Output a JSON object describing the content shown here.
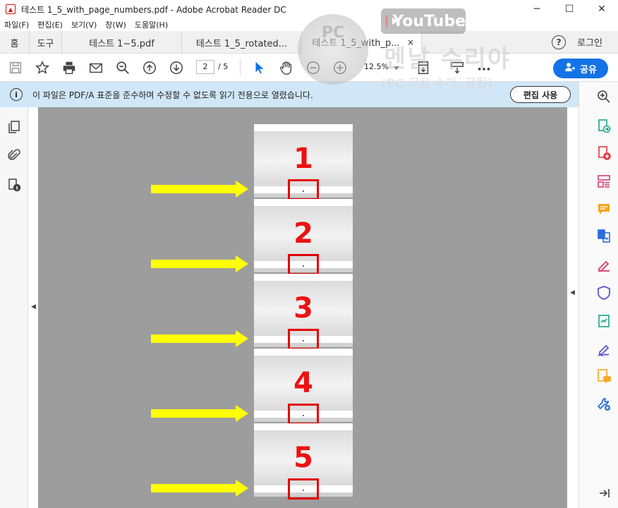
{
  "window": {
    "title": "테스트 1_5_with_page_numbers.pdf - Adobe Acrobat Reader DC",
    "minimize": "─",
    "maximize": "☐",
    "close": "✕"
  },
  "menu": [
    "파일(F)",
    "편집(E)",
    "보기(V)",
    "창(W)",
    "도움말(H)"
  ],
  "tabs": {
    "home": "홈",
    "tools": "도구",
    "docs": [
      "테스트 1~5.pdf",
      "테스트 1_5_rotated...",
      "테스트 1_5_with_p..."
    ],
    "close": "×",
    "help": "?",
    "login": "로그인"
  },
  "toolbar": {
    "page_current": "2",
    "page_total": "/ 5",
    "zoom": "12.5%",
    "share_label": "공유"
  },
  "banner": {
    "icon": "i",
    "message": "이 파일은 PDF/A 표준을 준수하며 수정할 수 없도록 읽기 전용으로 열렸습니다.",
    "edit_label": "편집 사용"
  },
  "pages": [
    "1",
    "2",
    "3",
    "4",
    "5"
  ],
  "watermark": {
    "youtube": "YouTube",
    "title": "멘날 수리야",
    "subtitle": "(PC 무료 수리, 꿀팁)",
    "badge": "PC"
  },
  "colors": {
    "accent": "#1473e6",
    "banner": "#d1e7f7",
    "page_number": "#ee1111",
    "highlight_box": "#e30000",
    "arrow": "#ffff00"
  }
}
